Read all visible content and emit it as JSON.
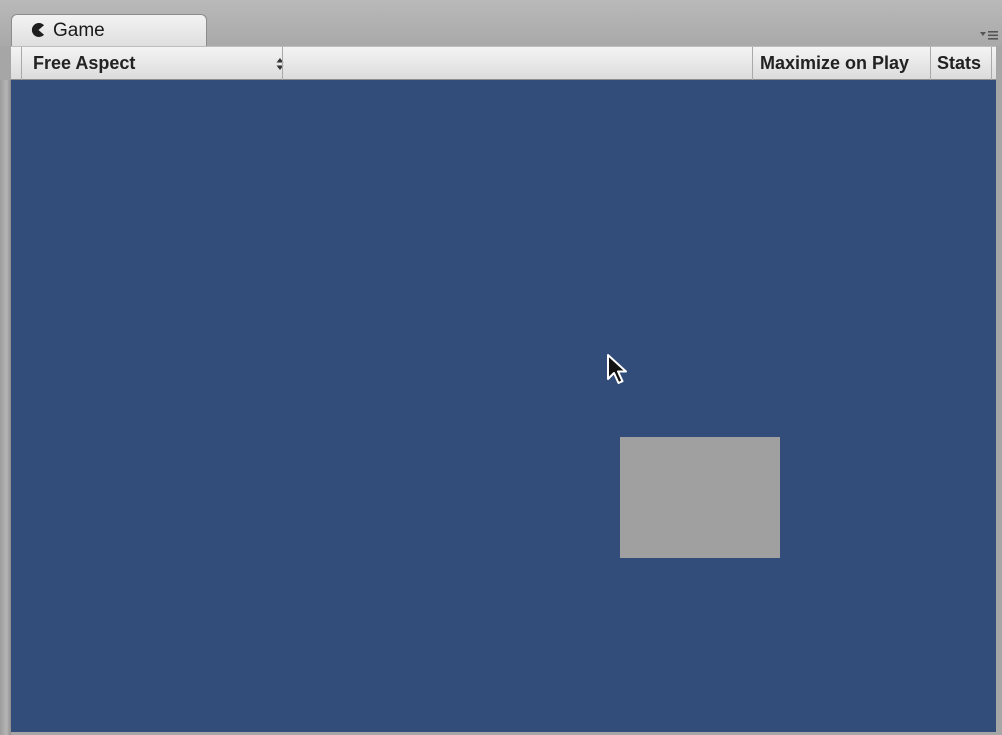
{
  "tab": {
    "label": "Game",
    "icon": "pacman-icon"
  },
  "toolbar": {
    "aspect": {
      "selected": "Free Aspect",
      "icon": "up-down-arrows-icon"
    },
    "maximize_on_play": "Maximize on Play",
    "stats": "Stats"
  },
  "pane_menu": {
    "icon": "dropdown-menu-icon"
  },
  "viewport": {
    "background_color": "#324d7a",
    "object_color": "#a0a0a0"
  }
}
